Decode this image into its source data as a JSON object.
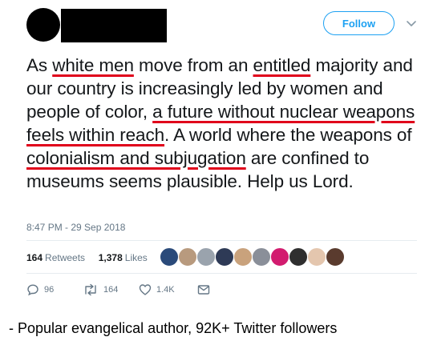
{
  "header": {
    "follow_label": "Follow"
  },
  "tweet": {
    "segments": [
      {
        "text": "As ",
        "hl": false
      },
      {
        "text": "white men",
        "hl": true
      },
      {
        "text": " move from an ",
        "hl": false
      },
      {
        "text": "entitled",
        "hl": true
      },
      {
        "text": " majority and our country is increasingly led by women and people of color, ",
        "hl": false
      },
      {
        "text": "a future without nuclear weapons feels within reach",
        "hl": true
      },
      {
        "text": ". A world where the weapons of ",
        "hl": false
      },
      {
        "text": "colonialism and subjugation",
        "hl": true
      },
      {
        "text": " are confined to museums seems plausible. Help us Lord.",
        "hl": false
      }
    ],
    "timestamp": "8:47 PM - 29 Sep 2018"
  },
  "stats": {
    "retweets_count": "164",
    "retweets_label": "Retweets",
    "likes_count": "1,378",
    "likes_label": "Likes",
    "liker_avatar_colors": [
      "#2a4a7a",
      "#b89a7e",
      "#9aa3ad",
      "#2e3a56",
      "#c9a27c",
      "#8a8f99",
      "#d21c6f",
      "#2f2f2f",
      "#e4c6ae",
      "#5a3b2e"
    ]
  },
  "actions": {
    "reply_count": "96",
    "retweet_count": "164",
    "like_count": "1.4K"
  },
  "caption": "- Popular evangelical author, 92K+ Twitter followers",
  "colors": {
    "accent": "#1da1f2",
    "highlight": "#e0001b",
    "muted": "#657786"
  }
}
